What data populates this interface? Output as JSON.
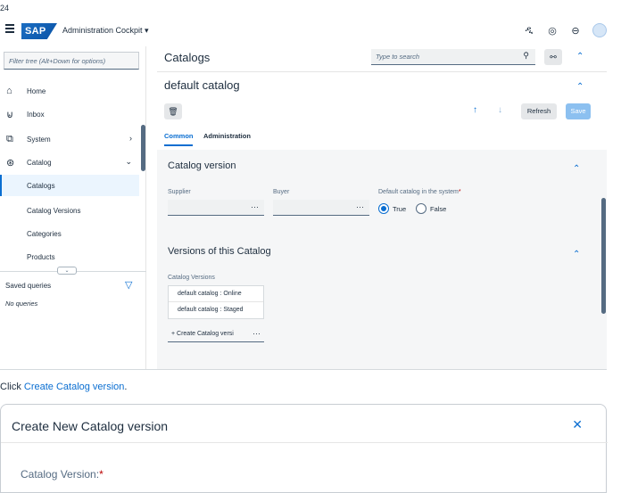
{
  "page_number": "24",
  "shell": {
    "title": "Administration Cockpit",
    "logo": "SAP"
  },
  "sidebar": {
    "filter_placeholder": "Filter tree (Alt+Down for options)",
    "items": [
      {
        "label": "Home",
        "icon": "home-icon"
      },
      {
        "label": "Inbox",
        "icon": "inbox-icon"
      },
      {
        "label": "System",
        "icon": "system-icon"
      },
      {
        "label": "Catalog",
        "icon": "catalog-icon"
      },
      {
        "label": "Catalogs"
      },
      {
        "label": "Catalog Versions"
      },
      {
        "label": "Categories"
      },
      {
        "label": "Products"
      }
    ],
    "saved_queries_label": "Saved queries",
    "no_queries_label": "No queries"
  },
  "main": {
    "header": "Catalogs",
    "search_placeholder": "Type to search",
    "detail_title": "default catalog",
    "refresh_label": "Refresh",
    "save_label": "Save",
    "tabs": [
      "Common",
      "Administration"
    ],
    "catalog_version_section": {
      "title": "Catalog version",
      "supplier_label": "Supplier",
      "buyer_label": "Buyer",
      "default_label": "Default catalog in the system",
      "true_label": "True",
      "false_label": "False"
    },
    "versions_section": {
      "title": "Versions of this Catalog",
      "list_label": "Catalog Versions",
      "items": [
        "default catalog : Online",
        "default catalog : Staged"
      ],
      "create_label": "+ Create Catalog versi"
    }
  },
  "instruction": {
    "prefix": "Click ",
    "link": "Create Catalog version",
    "suffix": "."
  },
  "dialog": {
    "title": "Create New Catalog version",
    "field_label": "Catalog Version:"
  }
}
